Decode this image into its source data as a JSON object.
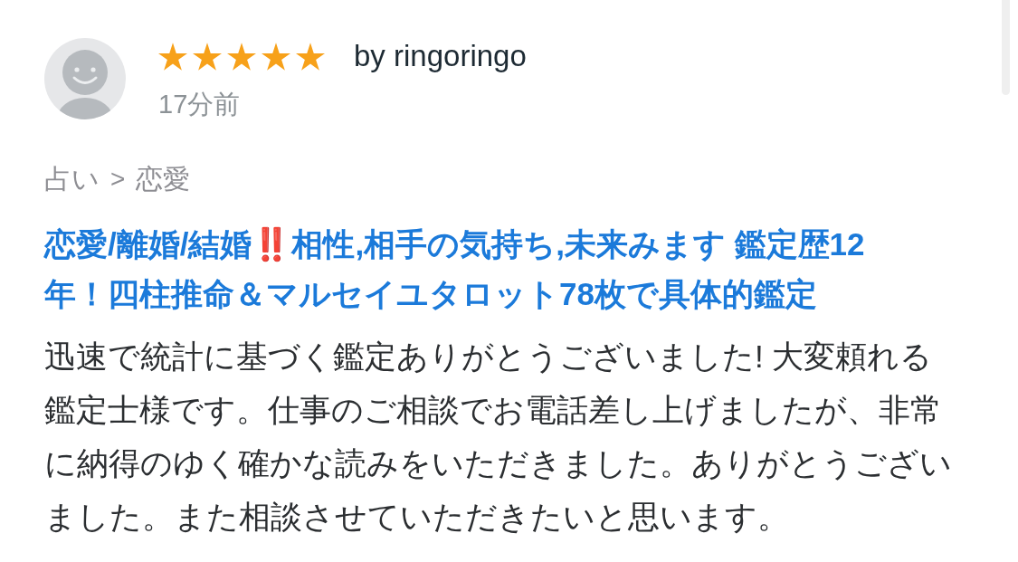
{
  "review": {
    "reviewer": "by ringoringo",
    "stars": 5,
    "time": "17分前",
    "breadcrumb": {
      "items": [
        "占い",
        "恋愛"
      ],
      "separator": ">"
    },
    "service_title": "恋愛/離婚/結婚‼️相性,相手の気持ち,未来みます 鑑定歴12年！四柱推命＆マルセイユタロット78枚で具体的鑑定",
    "body": "迅速で統計に基づく鑑定ありがとうございました! 大変頼れる鑑定士様です。仕事のご相談でお電話差し上げましたが、非常に納得のゆく確かな読みをいただきました。ありがとうございました。また相談させていただきたいと思います。"
  }
}
